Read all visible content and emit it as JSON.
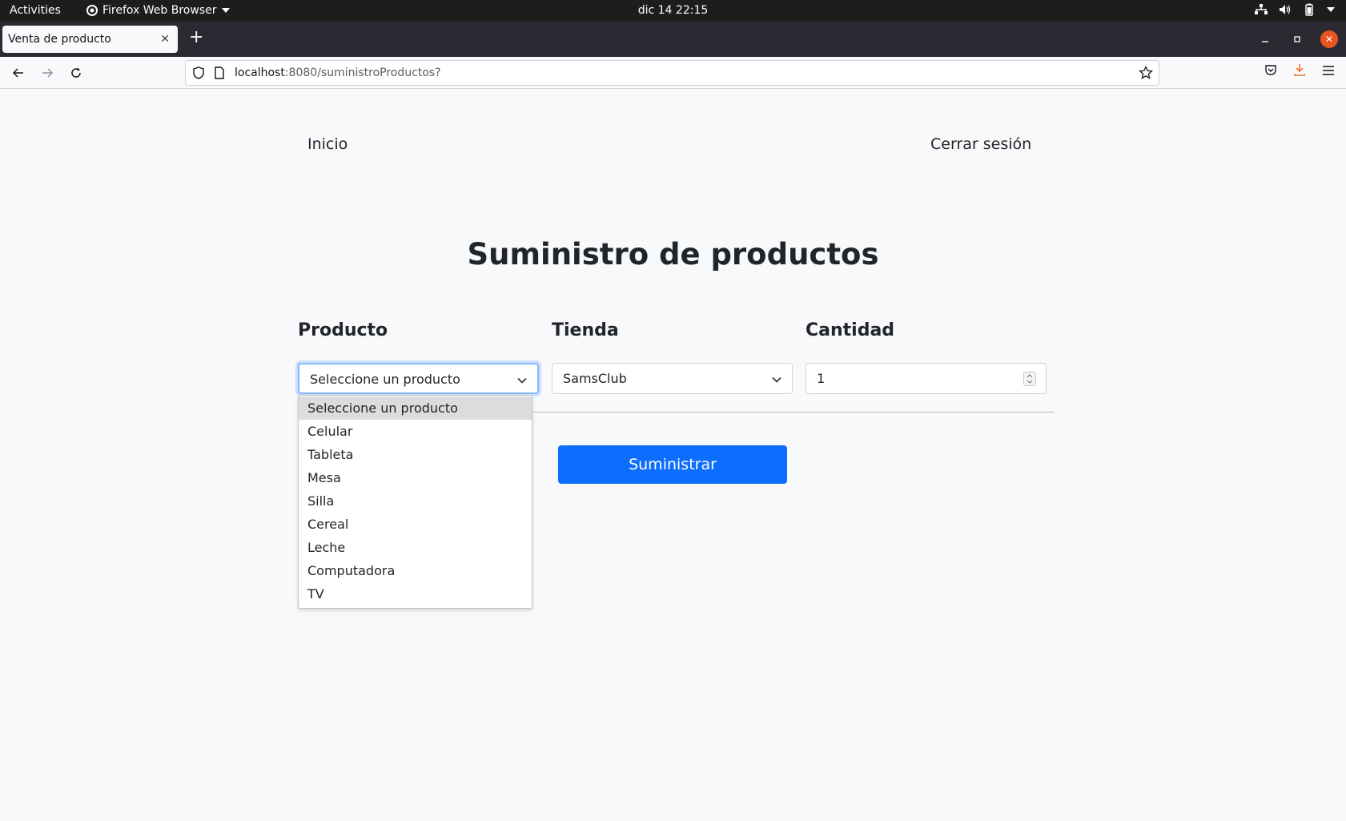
{
  "system_bar": {
    "activities": "Activities",
    "app_name": "Firefox Web Browser",
    "clock": "dic 14  22:15"
  },
  "browser": {
    "tab_title": "Venta de producto",
    "url_host": "localhost",
    "url_rest": ":8080/suministroProductos?"
  },
  "page": {
    "nav": {
      "home": "Inicio",
      "logout": "Cerrar sesión"
    },
    "title": "Suministro de productos",
    "producto": {
      "label": "Producto",
      "selected": "Seleccione un producto",
      "options": [
        "Seleccione un producto",
        "Celular",
        "Tableta",
        "Mesa",
        "Silla",
        "Cereal",
        "Leche",
        "Computadora",
        "TV"
      ]
    },
    "tienda": {
      "label": "Tienda",
      "selected": "SamsClub"
    },
    "cantidad": {
      "label": "Cantidad",
      "value": "1"
    },
    "submit_label": "Suministrar"
  },
  "colors": {
    "primary": "#0d6efd",
    "page_background": "#f8f9fa",
    "focus_ring": "#86b7fe"
  }
}
